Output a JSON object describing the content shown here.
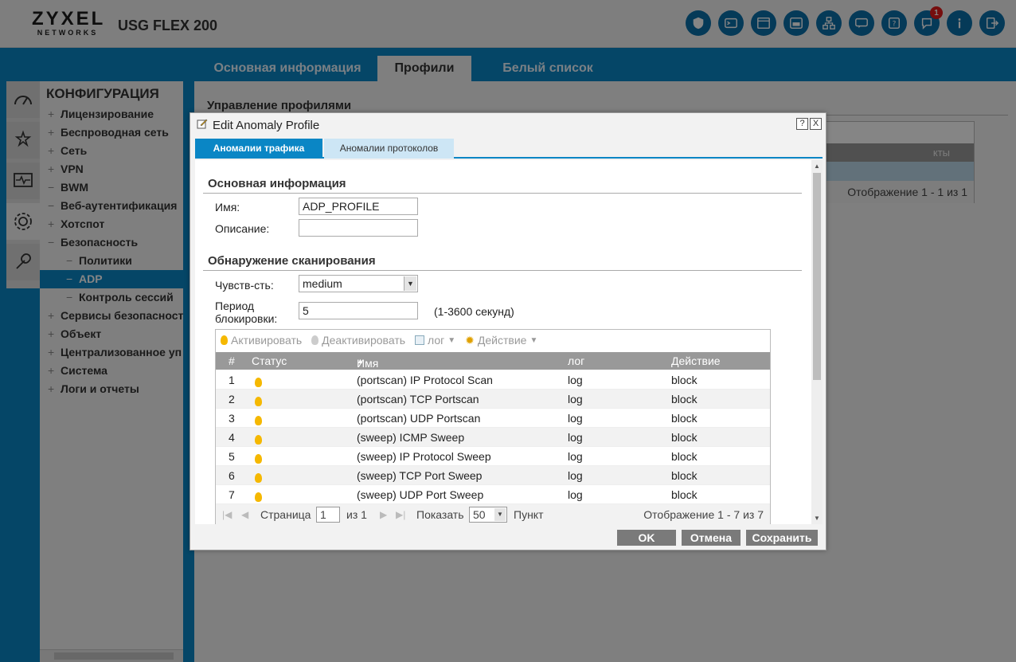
{
  "header": {
    "brand": "ZYXEL",
    "brand_sub": "NETWORKS",
    "model": "USG FLEX 200",
    "notification_count": "1"
  },
  "top_tabs": [
    {
      "label": "Основная информация"
    },
    {
      "label": "Профили"
    },
    {
      "label": "Белый список"
    }
  ],
  "nav": {
    "title": "КОНФИГУРАЦИЯ",
    "items": [
      {
        "pm": "+",
        "label": "Лицензирование"
      },
      {
        "pm": "+",
        "label": "Беспроводная сеть"
      },
      {
        "pm": "+",
        "label": "Сеть"
      },
      {
        "pm": "+",
        "label": "VPN"
      },
      {
        "pm": "−",
        "label": "BWM"
      },
      {
        "pm": "−",
        "label": "Веб-аутентификация"
      },
      {
        "pm": "+",
        "label": "Хотспот"
      },
      {
        "pm": "−",
        "label": "Безопасность"
      },
      {
        "pm": "−",
        "label": "Политики"
      },
      {
        "pm": "−",
        "label": "ADP"
      },
      {
        "pm": "−",
        "label": "Контроль сессий"
      },
      {
        "pm": "+",
        "label": "Сервисы безопасност"
      },
      {
        "pm": "+",
        "label": "Объект"
      },
      {
        "pm": "+",
        "label": "Централизованное уп"
      },
      {
        "pm": "+",
        "label": "Система"
      },
      {
        "pm": "+",
        "label": "Логи и отчеты"
      }
    ]
  },
  "main": {
    "title": "Управление профилями",
    "bg_header_fragment": "кты",
    "bg_footer": "Отображение 1 - 1 из 1"
  },
  "dialog": {
    "title": "Edit Anomaly Profile",
    "help": "?",
    "close": "X",
    "tabs": [
      {
        "label": "Аномалии трафика"
      },
      {
        "label": "Аномалии протоколов"
      }
    ],
    "basic": {
      "heading": "Основная информация",
      "name_label": "Имя:",
      "name_value": "ADP_PROFILE",
      "desc_label": "Описание:",
      "desc_value": ""
    },
    "scan": {
      "heading": "Обнаружение сканирования",
      "sens_label": "Чувств-сть:",
      "sens_value": "medium",
      "block_label_1": "Период",
      "block_label_2": "блокировки:",
      "block_value": "5",
      "block_hint": "(1-3600 секунд)"
    },
    "toolbar": {
      "activate": "Активировать",
      "deactivate": "Деактивировать",
      "log": "лог",
      "action": "Действие"
    },
    "columns": {
      "num": "#",
      "status": "Статус",
      "name": "Имя",
      "log": "лог",
      "action": "Действие"
    },
    "rows": [
      {
        "num": "1",
        "name": "(portscan) IP Protocol Scan",
        "log": "log",
        "action": "block"
      },
      {
        "num": "2",
        "name": "(portscan) TCP Portscan",
        "log": "log",
        "action": "block"
      },
      {
        "num": "3",
        "name": "(portscan) UDP Portscan",
        "log": "log",
        "action": "block"
      },
      {
        "num": "4",
        "name": "(sweep) ICMP Sweep",
        "log": "log",
        "action": "block"
      },
      {
        "num": "5",
        "name": "(sweep) IP Protocol Sweep",
        "log": "log",
        "action": "block"
      },
      {
        "num": "6",
        "name": "(sweep) TCP Port Sweep",
        "log": "log",
        "action": "block"
      },
      {
        "num": "7",
        "name": "(sweep) UDP Port Sweep",
        "log": "log",
        "action": "block"
      }
    ],
    "pager": {
      "page_label": "Страница",
      "page_value": "1",
      "of_label": "из 1",
      "show_label": "Показать",
      "show_value": "50",
      "item_label": "Пункт",
      "display_text": "Отображение 1 - 7 из 7"
    },
    "buttons": {
      "ok": "OK",
      "cancel": "Отмена",
      "save": "Сохранить"
    }
  },
  "colors": {
    "accent": "#0a86c5",
    "bulb": "#f5b800",
    "badge": "#e21b1b"
  }
}
